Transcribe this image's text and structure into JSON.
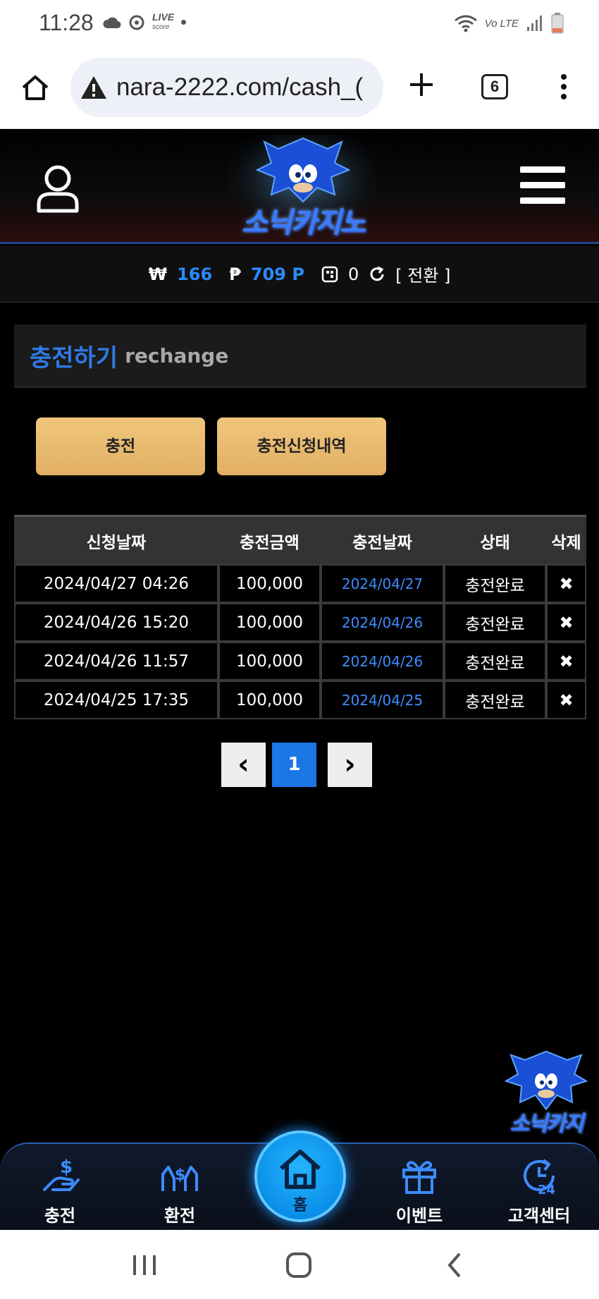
{
  "status_bar": {
    "time": "11:28",
    "live_label": "LIVE",
    "live_sub": "score",
    "network": "Vo LTE"
  },
  "browser": {
    "url": "nara-2222.com/cash_(",
    "tab_count": "6"
  },
  "header": {
    "logo_text": "소닉카지노"
  },
  "balance": {
    "won_symbol": "₩",
    "won_value": "166",
    "point_symbol": "₱",
    "point_value": "709 P",
    "chip_value": "0",
    "convert_label": "[ 전환 ]"
  },
  "section": {
    "title_ko": "충전하기",
    "title_en": "rechange"
  },
  "buttons": {
    "charge": "충전",
    "charge_history": "충전신청내역"
  },
  "table": {
    "headers": [
      "신청날짜",
      "충전금액",
      "충전날짜",
      "상태",
      "삭제"
    ],
    "rows": [
      {
        "request_date": "2024/04/27 04:26",
        "amount": "100,000",
        "charge_date": "2024/04/27",
        "status": "충전완료",
        "delete": "✖"
      },
      {
        "request_date": "2024/04/26 15:20",
        "amount": "100,000",
        "charge_date": "2024/04/26",
        "status": "충전완료",
        "delete": "✖"
      },
      {
        "request_date": "2024/04/26 11:57",
        "amount": "100,000",
        "charge_date": "2024/04/26",
        "status": "충전완료",
        "delete": "✖"
      },
      {
        "request_date": "2024/04/25 17:35",
        "amount": "100,000",
        "charge_date": "2024/04/25",
        "status": "충전완료",
        "delete": "✖"
      }
    ]
  },
  "pagination": {
    "prev": "‹",
    "current": "1",
    "next": "›"
  },
  "float_logo_text": "소닉카지",
  "bottom_nav": {
    "charge": "충전",
    "exchange": "환전",
    "home": "홈",
    "event": "이벤트",
    "support": "고객센터"
  },
  "colors": {
    "accent_blue": "#2a8cff",
    "gold_button": "#e8b86c",
    "home_circle": "#0a8fe8"
  }
}
